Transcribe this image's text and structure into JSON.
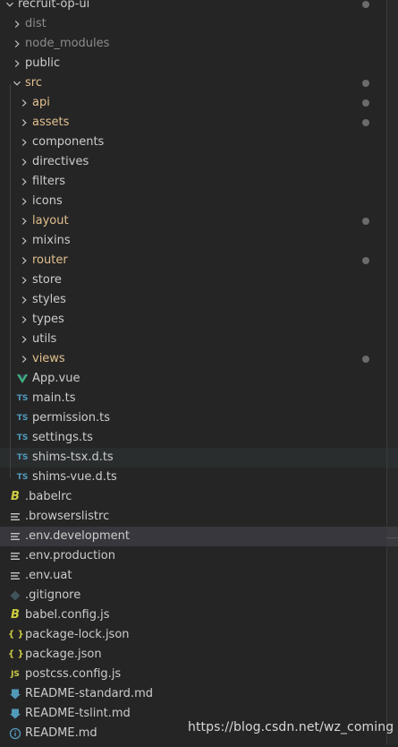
{
  "explorer": {
    "items": [
      {
        "label": "recruit-op-ui",
        "kind": "folder",
        "open": true,
        "depth": 0,
        "status": "",
        "dot": true
      },
      {
        "label": "dist",
        "kind": "folder",
        "open": false,
        "depth": 1,
        "status": "ignored",
        "dot": false
      },
      {
        "label": "node_modules",
        "kind": "folder",
        "open": false,
        "depth": 1,
        "status": "ignored",
        "dot": false
      },
      {
        "label": "public",
        "kind": "folder",
        "open": false,
        "depth": 1,
        "status": "",
        "dot": false
      },
      {
        "label": "src",
        "kind": "folder",
        "open": true,
        "depth": 1,
        "status": "modified",
        "dot": true
      },
      {
        "label": "api",
        "kind": "folder",
        "open": false,
        "depth": 2,
        "status": "modified",
        "dot": true
      },
      {
        "label": "assets",
        "kind": "folder",
        "open": false,
        "depth": 2,
        "status": "modified",
        "dot": true
      },
      {
        "label": "components",
        "kind": "folder",
        "open": false,
        "depth": 2,
        "status": "",
        "dot": false
      },
      {
        "label": "directives",
        "kind": "folder",
        "open": false,
        "depth": 2,
        "status": "",
        "dot": false
      },
      {
        "label": "filters",
        "kind": "folder",
        "open": false,
        "depth": 2,
        "status": "",
        "dot": false
      },
      {
        "label": "icons",
        "kind": "folder",
        "open": false,
        "depth": 2,
        "status": "",
        "dot": false
      },
      {
        "label": "layout",
        "kind": "folder",
        "open": false,
        "depth": 2,
        "status": "modified",
        "dot": true
      },
      {
        "label": "mixins",
        "kind": "folder",
        "open": false,
        "depth": 2,
        "status": "",
        "dot": false
      },
      {
        "label": "router",
        "kind": "folder",
        "open": false,
        "depth": 2,
        "status": "modified",
        "dot": true
      },
      {
        "label": "store",
        "kind": "folder",
        "open": false,
        "depth": 2,
        "status": "",
        "dot": false
      },
      {
        "label": "styles",
        "kind": "folder",
        "open": false,
        "depth": 2,
        "status": "",
        "dot": false
      },
      {
        "label": "types",
        "kind": "folder",
        "open": false,
        "depth": 2,
        "status": "",
        "dot": false
      },
      {
        "label": "utils",
        "kind": "folder",
        "open": false,
        "depth": 2,
        "status": "",
        "dot": false
      },
      {
        "label": "views",
        "kind": "folder",
        "open": false,
        "depth": 2,
        "status": "modified",
        "dot": true
      },
      {
        "label": "App.vue",
        "kind": "file",
        "icon": "vue",
        "depth": 2,
        "status": "",
        "dot": false
      },
      {
        "label": "main.ts",
        "kind": "file",
        "icon": "ts",
        "depth": 2,
        "status": "",
        "dot": false
      },
      {
        "label": "permission.ts",
        "kind": "file",
        "icon": "ts",
        "depth": 2,
        "status": "",
        "dot": false
      },
      {
        "label": "settings.ts",
        "kind": "file",
        "icon": "ts",
        "depth": 2,
        "status": "",
        "dot": false
      },
      {
        "label": "shims-tsx.d.ts",
        "kind": "file",
        "icon": "ts",
        "depth": 2,
        "status": "",
        "dot": false,
        "state": "hover"
      },
      {
        "label": "shims-vue.d.ts",
        "kind": "file",
        "icon": "ts",
        "depth": 2,
        "status": "",
        "dot": false
      },
      {
        "label": ".babelrc",
        "kind": "file",
        "icon": "babel",
        "depth": 1,
        "status": "",
        "dot": false
      },
      {
        "label": ".browserslistrc",
        "kind": "file",
        "icon": "lines",
        "depth": 1,
        "status": "",
        "dot": false
      },
      {
        "label": ".env.development",
        "kind": "file",
        "icon": "lines",
        "depth": 1,
        "status": "",
        "dot": false,
        "state": "selected"
      },
      {
        "label": ".env.production",
        "kind": "file",
        "icon": "lines",
        "depth": 1,
        "status": "",
        "dot": false
      },
      {
        "label": ".env.uat",
        "kind": "file",
        "icon": "lines",
        "depth": 1,
        "status": "",
        "dot": false
      },
      {
        "label": ".gitignore",
        "kind": "file",
        "icon": "git",
        "depth": 1,
        "status": "",
        "dot": false
      },
      {
        "label": "babel.config.js",
        "kind": "file",
        "icon": "babel",
        "depth": 1,
        "status": "",
        "dot": false
      },
      {
        "label": "package-lock.json",
        "kind": "file",
        "icon": "json",
        "depth": 1,
        "status": "",
        "dot": false
      },
      {
        "label": "package.json",
        "kind": "file",
        "icon": "json",
        "depth": 1,
        "status": "",
        "dot": false
      },
      {
        "label": "postcss.config.js",
        "kind": "file",
        "icon": "js",
        "depth": 1,
        "status": "",
        "dot": false
      },
      {
        "label": "README-standard.md",
        "kind": "file",
        "icon": "md",
        "depth": 1,
        "status": "",
        "dot": false
      },
      {
        "label": "README-tslint.md",
        "kind": "file",
        "icon": "md",
        "depth": 1,
        "status": "",
        "dot": false
      },
      {
        "label": "README.md",
        "kind": "file",
        "icon": "info",
        "depth": 1,
        "status": "",
        "dot": false
      }
    ]
  },
  "icons": {
    "ts": "TS",
    "js": "JS",
    "json": "{ }",
    "babel": "B"
  },
  "colors": {
    "background": "#252526",
    "text": "#cccccc",
    "modified": "#e2c08d",
    "ignored": "#8c8c8c",
    "typescript": "#519aba",
    "javascript": "#cbcb41",
    "vue": "#41b883",
    "markdown": "#519aba",
    "git": "#41535b"
  },
  "watermark": {
    "text": "https://blog.csdn.net/wz_coming"
  }
}
